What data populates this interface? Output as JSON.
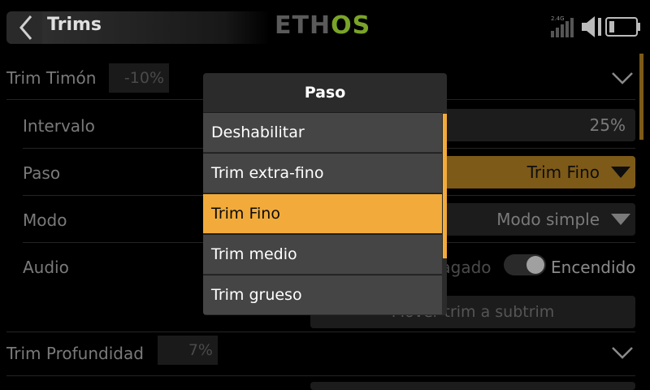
{
  "header": {
    "title": "Trims",
    "logo_left": "ETH",
    "logo_right": "OS",
    "rf_label": "2.4G"
  },
  "rows": {
    "trim_timon": {
      "label": "Trim Timón",
      "value": "-10%"
    },
    "intervalo": {
      "label": "Intervalo",
      "value": "25%"
    },
    "paso": {
      "label": "Paso",
      "value": "Trim Fino"
    },
    "modo": {
      "label": "Modo",
      "value": "Modo simple"
    },
    "audio": {
      "label": "Audio",
      "off_label": "Apagado",
      "on_label": "Encendido",
      "on": true
    },
    "move_button": "Mover trim a subtrim",
    "trim_profundidad": {
      "label": "Trim Profundidad",
      "value": "7%"
    }
  },
  "popup": {
    "title": "Paso",
    "options": [
      "Deshabilitar",
      "Trim extra-fino",
      "Trim Fino",
      "Trim medio",
      "Trim grueso"
    ],
    "selected_index": 2
  },
  "colors": {
    "accent": "#f2ab3a",
    "accent_dim": "#7d5a18",
    "logo_green": "#7aa428"
  }
}
